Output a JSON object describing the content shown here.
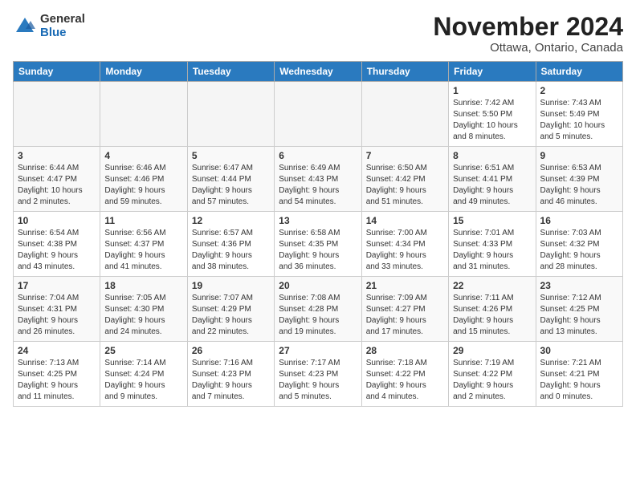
{
  "logo": {
    "general": "General",
    "blue": "Blue"
  },
  "title": "November 2024",
  "location": "Ottawa, Ontario, Canada",
  "weekdays": [
    "Sunday",
    "Monday",
    "Tuesday",
    "Wednesday",
    "Thursday",
    "Friday",
    "Saturday"
  ],
  "weeks": [
    [
      {
        "day": "",
        "info": ""
      },
      {
        "day": "",
        "info": ""
      },
      {
        "day": "",
        "info": ""
      },
      {
        "day": "",
        "info": ""
      },
      {
        "day": "",
        "info": ""
      },
      {
        "day": "1",
        "info": "Sunrise: 7:42 AM\nSunset: 5:50 PM\nDaylight: 10 hours\nand 8 minutes."
      },
      {
        "day": "2",
        "info": "Sunrise: 7:43 AM\nSunset: 5:49 PM\nDaylight: 10 hours\nand 5 minutes."
      }
    ],
    [
      {
        "day": "3",
        "info": "Sunrise: 6:44 AM\nSunset: 4:47 PM\nDaylight: 10 hours\nand 2 minutes."
      },
      {
        "day": "4",
        "info": "Sunrise: 6:46 AM\nSunset: 4:46 PM\nDaylight: 9 hours\nand 59 minutes."
      },
      {
        "day": "5",
        "info": "Sunrise: 6:47 AM\nSunset: 4:44 PM\nDaylight: 9 hours\nand 57 minutes."
      },
      {
        "day": "6",
        "info": "Sunrise: 6:49 AM\nSunset: 4:43 PM\nDaylight: 9 hours\nand 54 minutes."
      },
      {
        "day": "7",
        "info": "Sunrise: 6:50 AM\nSunset: 4:42 PM\nDaylight: 9 hours\nand 51 minutes."
      },
      {
        "day": "8",
        "info": "Sunrise: 6:51 AM\nSunset: 4:41 PM\nDaylight: 9 hours\nand 49 minutes."
      },
      {
        "day": "9",
        "info": "Sunrise: 6:53 AM\nSunset: 4:39 PM\nDaylight: 9 hours\nand 46 minutes."
      }
    ],
    [
      {
        "day": "10",
        "info": "Sunrise: 6:54 AM\nSunset: 4:38 PM\nDaylight: 9 hours\nand 43 minutes."
      },
      {
        "day": "11",
        "info": "Sunrise: 6:56 AM\nSunset: 4:37 PM\nDaylight: 9 hours\nand 41 minutes."
      },
      {
        "day": "12",
        "info": "Sunrise: 6:57 AM\nSunset: 4:36 PM\nDaylight: 9 hours\nand 38 minutes."
      },
      {
        "day": "13",
        "info": "Sunrise: 6:58 AM\nSunset: 4:35 PM\nDaylight: 9 hours\nand 36 minutes."
      },
      {
        "day": "14",
        "info": "Sunrise: 7:00 AM\nSunset: 4:34 PM\nDaylight: 9 hours\nand 33 minutes."
      },
      {
        "day": "15",
        "info": "Sunrise: 7:01 AM\nSunset: 4:33 PM\nDaylight: 9 hours\nand 31 minutes."
      },
      {
        "day": "16",
        "info": "Sunrise: 7:03 AM\nSunset: 4:32 PM\nDaylight: 9 hours\nand 28 minutes."
      }
    ],
    [
      {
        "day": "17",
        "info": "Sunrise: 7:04 AM\nSunset: 4:31 PM\nDaylight: 9 hours\nand 26 minutes."
      },
      {
        "day": "18",
        "info": "Sunrise: 7:05 AM\nSunset: 4:30 PM\nDaylight: 9 hours\nand 24 minutes."
      },
      {
        "day": "19",
        "info": "Sunrise: 7:07 AM\nSunset: 4:29 PM\nDaylight: 9 hours\nand 22 minutes."
      },
      {
        "day": "20",
        "info": "Sunrise: 7:08 AM\nSunset: 4:28 PM\nDaylight: 9 hours\nand 19 minutes."
      },
      {
        "day": "21",
        "info": "Sunrise: 7:09 AM\nSunset: 4:27 PM\nDaylight: 9 hours\nand 17 minutes."
      },
      {
        "day": "22",
        "info": "Sunrise: 7:11 AM\nSunset: 4:26 PM\nDaylight: 9 hours\nand 15 minutes."
      },
      {
        "day": "23",
        "info": "Sunrise: 7:12 AM\nSunset: 4:25 PM\nDaylight: 9 hours\nand 13 minutes."
      }
    ],
    [
      {
        "day": "24",
        "info": "Sunrise: 7:13 AM\nSunset: 4:25 PM\nDaylight: 9 hours\nand 11 minutes."
      },
      {
        "day": "25",
        "info": "Sunrise: 7:14 AM\nSunset: 4:24 PM\nDaylight: 9 hours\nand 9 minutes."
      },
      {
        "day": "26",
        "info": "Sunrise: 7:16 AM\nSunset: 4:23 PM\nDaylight: 9 hours\nand 7 minutes."
      },
      {
        "day": "27",
        "info": "Sunrise: 7:17 AM\nSunset: 4:23 PM\nDaylight: 9 hours\nand 5 minutes."
      },
      {
        "day": "28",
        "info": "Sunrise: 7:18 AM\nSunset: 4:22 PM\nDaylight: 9 hours\nand 4 minutes."
      },
      {
        "day": "29",
        "info": "Sunrise: 7:19 AM\nSunset: 4:22 PM\nDaylight: 9 hours\nand 2 minutes."
      },
      {
        "day": "30",
        "info": "Sunrise: 7:21 AM\nSunset: 4:21 PM\nDaylight: 9 hours\nand 0 minutes."
      }
    ]
  ]
}
